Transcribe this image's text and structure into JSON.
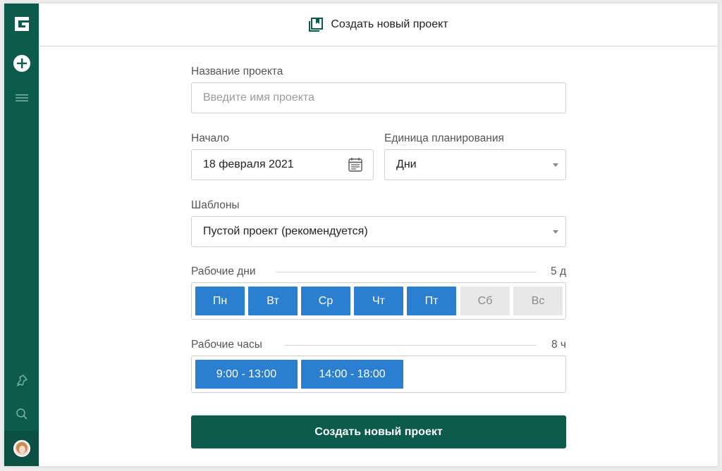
{
  "header": {
    "title": "Создать новый проект",
    "icon": "project-book-icon"
  },
  "sidebar": {
    "logo": "G",
    "icons": [
      "plus-circle-icon",
      "menu-icon",
      "bell-icon",
      "search-icon",
      "avatar"
    ]
  },
  "form": {
    "name": {
      "label": "Название проекта",
      "placeholder": "Введите имя проекта"
    },
    "start": {
      "label": "Начало",
      "value": "18 февраля 2021"
    },
    "unit": {
      "label": "Единица планирования",
      "value": "Дни"
    },
    "templates": {
      "label": "Шаблоны",
      "value": "Пустой проект (рекомендуется)"
    },
    "workdays": {
      "label": "Рабочие дни",
      "count": "5 д",
      "days": [
        {
          "label": "Пн",
          "active": true
        },
        {
          "label": "Вт",
          "active": true
        },
        {
          "label": "Ср",
          "active": true
        },
        {
          "label": "Чт",
          "active": true
        },
        {
          "label": "Пт",
          "active": true
        },
        {
          "label": "Сб",
          "active": false
        },
        {
          "label": "Вс",
          "active": false
        }
      ]
    },
    "workhours": {
      "label": "Рабочие часы",
      "count": "8 ч",
      "slots": [
        "9:00 - 13:00",
        "14:00 - 18:00"
      ]
    },
    "submit_label": "Создать новый проект"
  },
  "colors": {
    "sidebar": "#0c5b4d",
    "accent": "#2a7fd0",
    "submit": "#0c5b4d"
  }
}
